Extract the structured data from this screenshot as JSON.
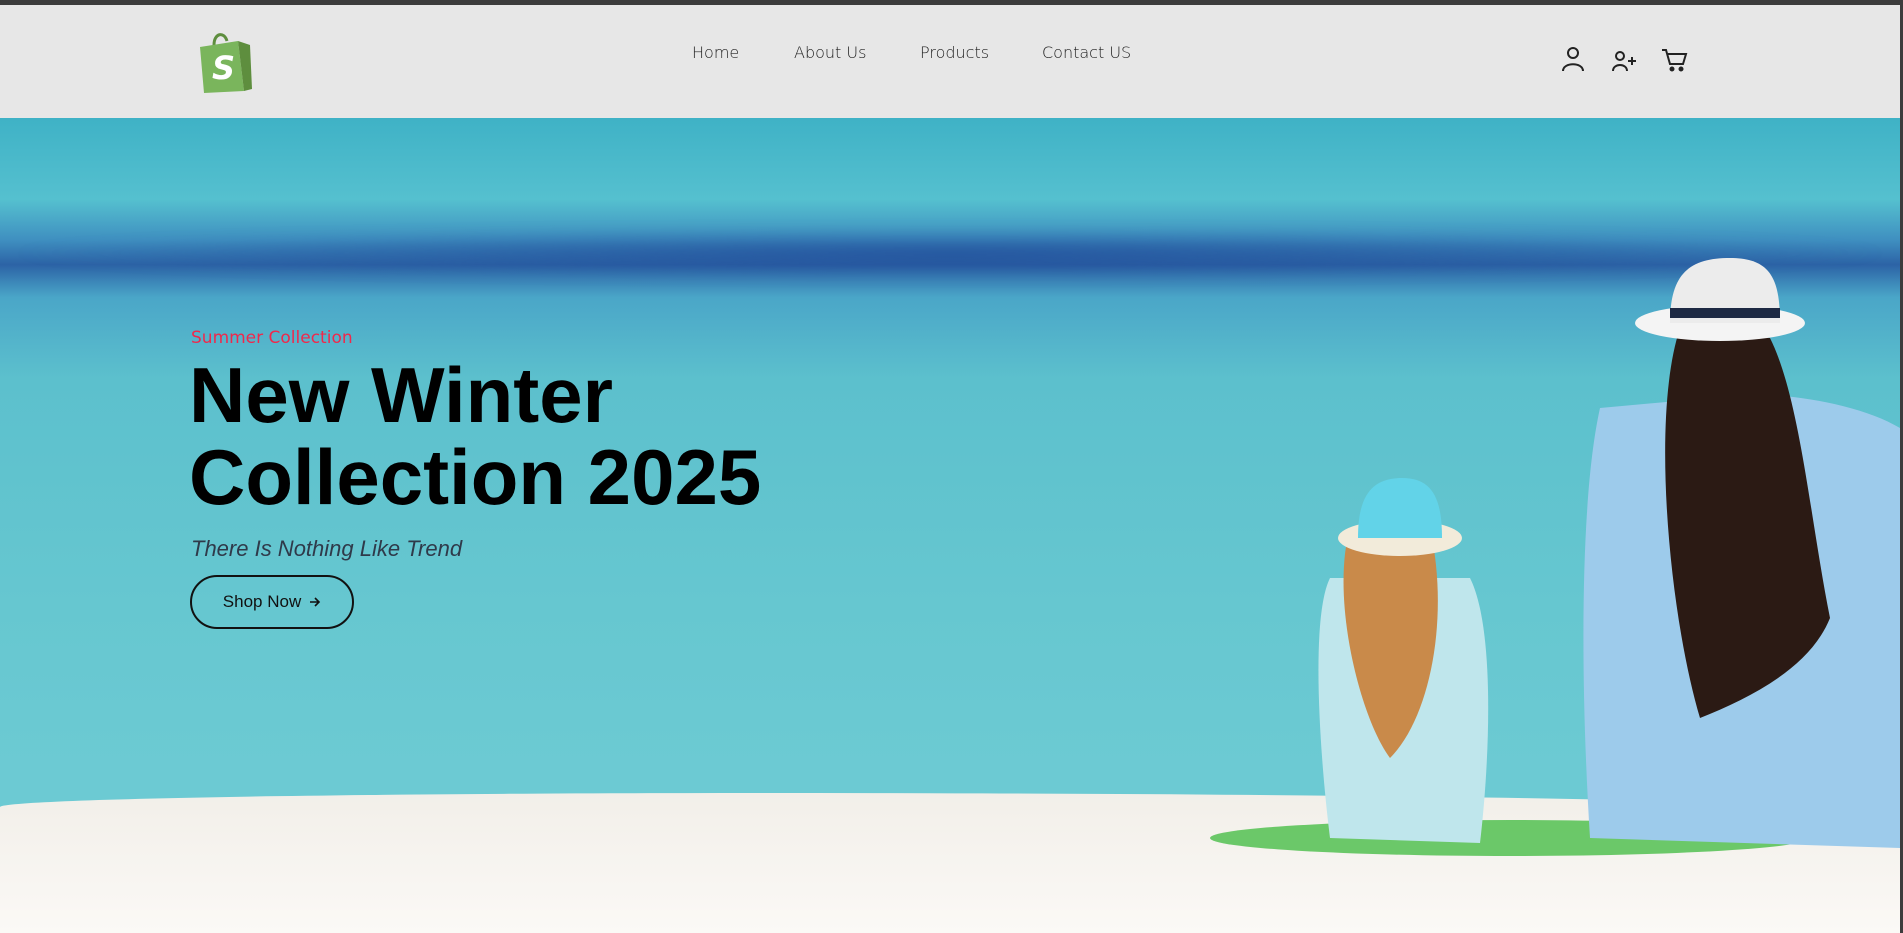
{
  "header": {
    "logo_icon": "shopify-bag-icon",
    "nav": [
      {
        "label": "Home"
      },
      {
        "label": "About Us"
      },
      {
        "label": "Products"
      },
      {
        "label": "Contact US"
      }
    ],
    "icons": [
      "user-icon",
      "user-plus-icon",
      "cart-icon"
    ]
  },
  "hero": {
    "eyebrow": "Summer Collection",
    "title_line1": "New Winter",
    "title_line2": "Collection 2025",
    "subtitle": "There Is Nothing Like Trend",
    "cta_label": "Shop Now",
    "cta_icon": "arrow-right-icon"
  },
  "colors": {
    "accent": "#f0284b",
    "header_bg": "#e7e7e7",
    "logo_green": "#7ab55c"
  }
}
